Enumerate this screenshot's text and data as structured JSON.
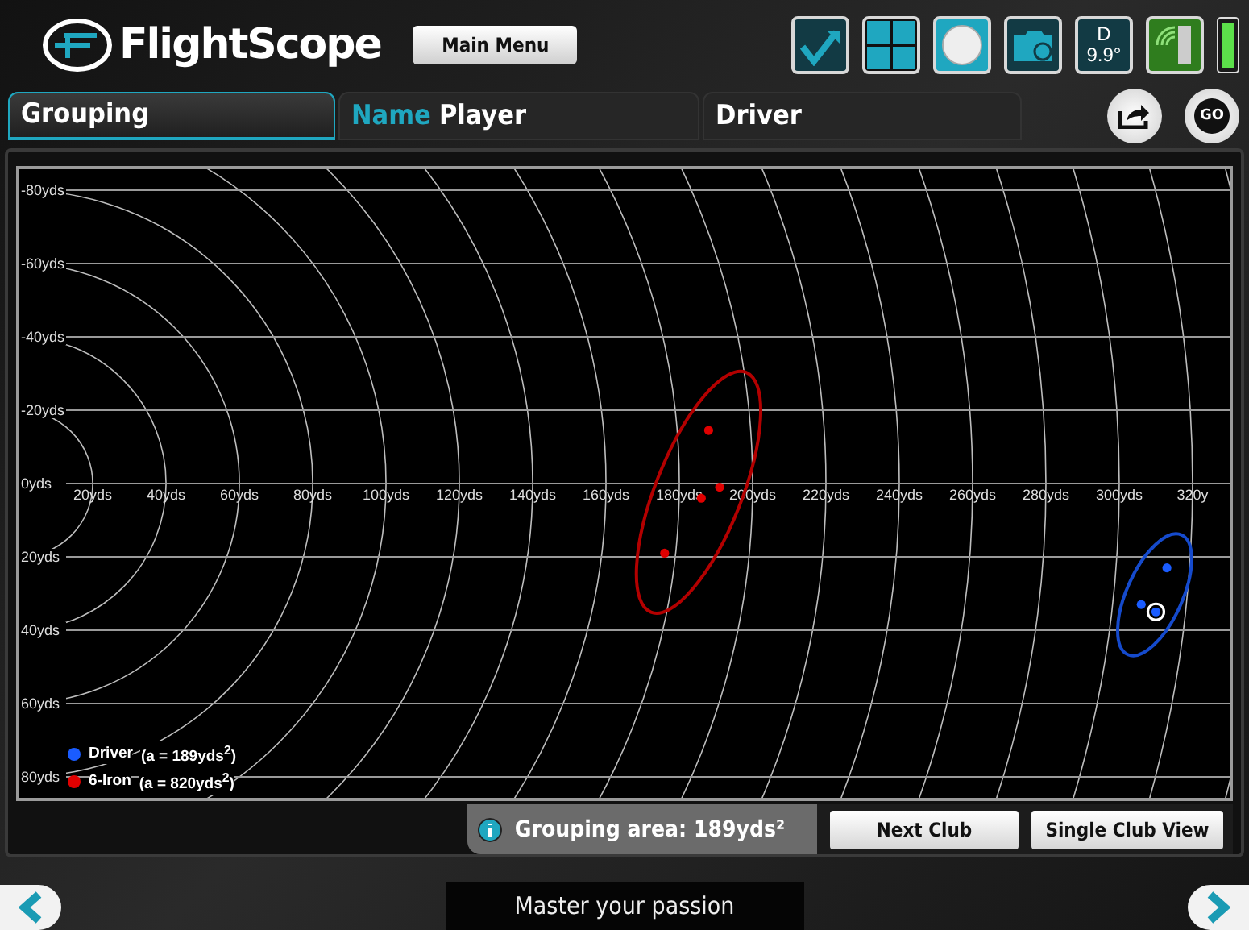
{
  "header": {
    "logo": "FlightScope",
    "main_menu": "Main Menu",
    "launch_tile": {
      "label": "D",
      "value": "9.9°"
    }
  },
  "tabs": [
    {
      "label": "Grouping",
      "selected": true
    },
    {
      "prefix": "Name",
      "label": "Player",
      "selected": false
    },
    {
      "label": "Driver",
      "selected": false
    }
  ],
  "go_button": "GO",
  "chart_data": {
    "type": "scatter",
    "grid": true,
    "xlim": [
      -0.9,
      331
    ],
    "ylim": [
      86.6,
      -86.6
    ],
    "xticks": [
      {
        "value": 20,
        "label": "20yds"
      },
      {
        "value": 40,
        "label": "40yds"
      },
      {
        "value": 60,
        "label": "60yds"
      },
      {
        "value": 80,
        "label": "80yds"
      },
      {
        "value": 100,
        "label": "100yds"
      },
      {
        "value": 120,
        "label": "120yds"
      },
      {
        "value": 140,
        "label": "140yds"
      },
      {
        "value": 160,
        "label": "160yds"
      },
      {
        "value": 180,
        "label": "180yds"
      },
      {
        "value": 200,
        "label": "200yds"
      },
      {
        "value": 220,
        "label": "220yds"
      },
      {
        "value": 240,
        "label": "240yds"
      },
      {
        "value": 260,
        "label": "260yds"
      },
      {
        "value": 280,
        "label": "280yds"
      },
      {
        "value": 300,
        "label": "300yds"
      },
      {
        "value": 320,
        "label": "320y"
      }
    ],
    "yticks": [
      {
        "value": -80,
        "label": "-80yds"
      },
      {
        "value": -60,
        "label": "-60yds"
      },
      {
        "value": -40,
        "label": "-40yds"
      },
      {
        "value": -20,
        "label": "-20yds"
      },
      {
        "value": 0,
        "label": "0yds"
      },
      {
        "value": 20,
        "label": "20yds"
      },
      {
        "value": 40,
        "label": "40yds"
      },
      {
        "value": 60,
        "label": "60yds"
      },
      {
        "value": 80,
        "label": "80yds"
      }
    ],
    "series": [
      {
        "name": "Driver",
        "color": "#1a5cff",
        "x": [
          313,
          306,
          310
        ],
        "values": [
          23,
          33,
          35
        ]
      },
      {
        "name": "6-Iron",
        "color": "#e00000",
        "x": [
          188,
          191,
          186,
          176
        ],
        "values": [
          -14.5,
          1,
          4,
          19
        ]
      }
    ]
  },
  "legend": [
    {
      "area": "(a = 189yds$^{2}$)"
    },
    {
      "area": "(a = 820yds$^{2}$)"
    }
  ],
  "info": "Grouping area: 189yds²",
  "buttons": [
    "Next Club",
    "Single Club View"
  ],
  "tagline": "Master your passion"
}
